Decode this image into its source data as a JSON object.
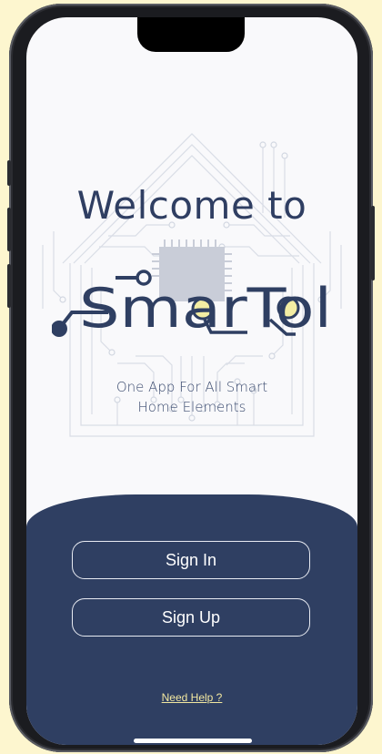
{
  "welcome": {
    "line1": "Welcome to"
  },
  "logo": {
    "text": "SmarTol"
  },
  "tagline": {
    "line1": "One App For All Smart",
    "line2": "Home Elements"
  },
  "auth": {
    "sign_in_label": "Sign In",
    "sign_up_label": "Sign Up"
  },
  "help": {
    "label": "Need Help ?"
  },
  "colors": {
    "primary": "#2f3f62",
    "accent_yellow": "#f3eda3",
    "background": "#fdf6cf",
    "screen": "#f9f9fb",
    "chip": "#c9cdd8"
  }
}
